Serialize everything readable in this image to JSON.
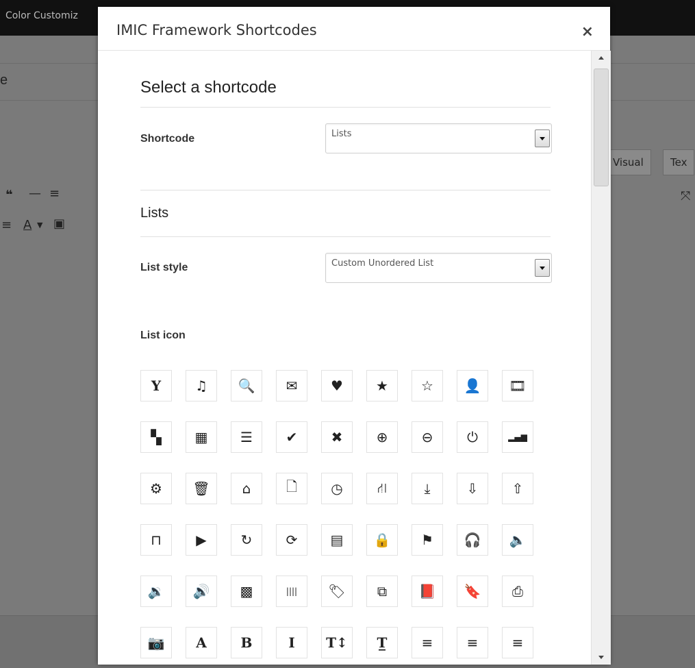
{
  "background": {
    "topbar_title": "Color Customiz",
    "tab_visual": "Visual",
    "tab_text": "Tex",
    "partial_heading": "e"
  },
  "modal": {
    "title": "IMIC Framework Shortcodes",
    "close_label": "×"
  },
  "form": {
    "section_title": "Select a shortcode",
    "shortcode_label": "Shortcode",
    "shortcode_value": "Lists",
    "lists_title": "Lists",
    "list_style_label": "List style",
    "list_style_value": "Custom Unordered List",
    "list_icon_label": "List icon"
  },
  "icons": [
    {
      "name": "glass-icon",
      "glyph": "Y",
      "serif": true
    },
    {
      "name": "music-icon",
      "glyph": "♫"
    },
    {
      "name": "search-icon",
      "glyph": "🔍"
    },
    {
      "name": "envelope-icon",
      "glyph": "✉"
    },
    {
      "name": "heart-icon",
      "glyph": "♥"
    },
    {
      "name": "star-icon",
      "glyph": "★"
    },
    {
      "name": "star-empty-icon",
      "glyph": "☆"
    },
    {
      "name": "user-icon",
      "glyph": "👤"
    },
    {
      "name": "film-icon",
      "glyph": "🎞"
    },
    {
      "name": "th-large-icon",
      "glyph": "▚"
    },
    {
      "name": "th-icon",
      "glyph": "▦"
    },
    {
      "name": "th-list-icon",
      "glyph": "☰"
    },
    {
      "name": "check-icon",
      "glyph": "✔"
    },
    {
      "name": "remove-icon",
      "glyph": "✖"
    },
    {
      "name": "zoom-in-icon",
      "glyph": "⊕"
    },
    {
      "name": "zoom-out-icon",
      "glyph": "⊖"
    },
    {
      "name": "off-icon",
      "glyph": "⏻"
    },
    {
      "name": "signal-icon",
      "glyph": "▂▄▆"
    },
    {
      "name": "cog-icon",
      "glyph": "⚙"
    },
    {
      "name": "trash-icon",
      "glyph": "🗑"
    },
    {
      "name": "home-icon",
      "glyph": "⌂"
    },
    {
      "name": "file-icon",
      "glyph": "🗋"
    },
    {
      "name": "time-icon",
      "glyph": "◷"
    },
    {
      "name": "road-icon",
      "glyph": "⛙"
    },
    {
      "name": "download-alt-icon",
      "glyph": "⤓"
    },
    {
      "name": "download-icon",
      "glyph": "⇩"
    },
    {
      "name": "upload-icon",
      "glyph": "⇧"
    },
    {
      "name": "inbox-icon",
      "glyph": "⊓"
    },
    {
      "name": "play-circle-icon",
      "glyph": "▶"
    },
    {
      "name": "repeat-icon",
      "glyph": "↻"
    },
    {
      "name": "refresh-icon",
      "glyph": "⟳"
    },
    {
      "name": "list-alt-icon",
      "glyph": "▤"
    },
    {
      "name": "lock-icon",
      "glyph": "🔒"
    },
    {
      "name": "flag-icon",
      "glyph": "⚑"
    },
    {
      "name": "headphones-icon",
      "glyph": "🎧"
    },
    {
      "name": "volume-off-icon",
      "glyph": "🔈"
    },
    {
      "name": "volume-down-icon",
      "glyph": "🔉"
    },
    {
      "name": "volume-up-icon",
      "glyph": "🔊"
    },
    {
      "name": "qrcode-icon",
      "glyph": "▩"
    },
    {
      "name": "barcode-icon",
      "glyph": "||||"
    },
    {
      "name": "tag-icon",
      "glyph": "🏷"
    },
    {
      "name": "tags-icon",
      "glyph": "⧉"
    },
    {
      "name": "book-icon",
      "glyph": "📕"
    },
    {
      "name": "bookmark-icon",
      "glyph": "🔖"
    },
    {
      "name": "print-icon",
      "glyph": "⎙"
    },
    {
      "name": "camera-icon",
      "glyph": "📷"
    },
    {
      "name": "font-icon",
      "glyph": "A",
      "serif": true
    },
    {
      "name": "bold-icon",
      "glyph": "B",
      "serif": true
    },
    {
      "name": "italic-icon",
      "glyph": "I",
      "serif": true
    },
    {
      "name": "text-height-icon",
      "glyph": "T↕",
      "serif": true
    },
    {
      "name": "text-width-icon",
      "glyph": "T̲",
      "serif": true
    },
    {
      "name": "align-left-icon",
      "glyph": "≡"
    },
    {
      "name": "align-center-icon",
      "glyph": "≡"
    },
    {
      "name": "align-right-icon",
      "glyph": "≡"
    }
  ]
}
